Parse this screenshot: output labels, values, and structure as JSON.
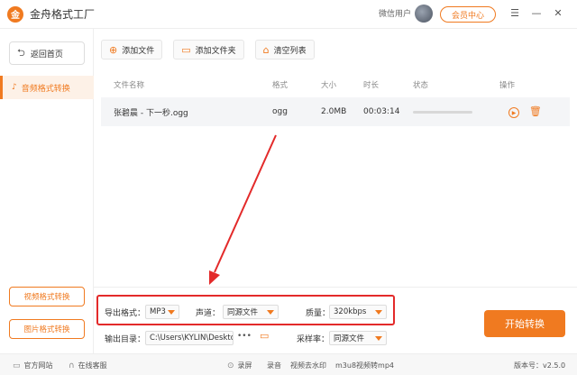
{
  "app": {
    "title": "金舟格式工厂",
    "logo_glyph": "金"
  },
  "header": {
    "user_label": "微信用户",
    "vip_label": "会员中心",
    "accent_color": "#f07a20"
  },
  "sidebar": {
    "back_label": "返回首页",
    "active_label": "音频格式转换",
    "video_label": "视频格式转换",
    "image_label": "图片格式转换"
  },
  "toolbar": {
    "add_file": "添加文件",
    "add_folder": "添加文件夹",
    "clear_list": "清空列表"
  },
  "table": {
    "headers": [
      "文件名称",
      "格式",
      "大小",
      "时长",
      "状态",
      "操作"
    ],
    "rows": [
      {
        "name": "张碧晨 - 下一秒.ogg",
        "format": "ogg",
        "size": "2.0MB",
        "duration": "00:03:14",
        "progress": 0
      }
    ]
  },
  "settings": {
    "output_format_label": "导出格式：",
    "output_format_value": "MP3",
    "channel_label": "声道：",
    "channel_value": "同源文件",
    "quality_label": "质量：",
    "quality_value": "320kbps",
    "output_dir_label": "输出目录：",
    "output_dir_value": "C:\\Users\\KYLIN\\Desktop\\",
    "sample_rate_label": "采样率：",
    "sample_rate_value": "同源文件",
    "start_label": "开始转换"
  },
  "statusbar": {
    "website": "官方网站",
    "support": "在线客服",
    "record_screen": "录屏",
    "record_audio": "录音",
    "watermark": "视频去水印",
    "m3u8": "m3u8视频转mp4",
    "version": "版本号：v2.5.0"
  }
}
